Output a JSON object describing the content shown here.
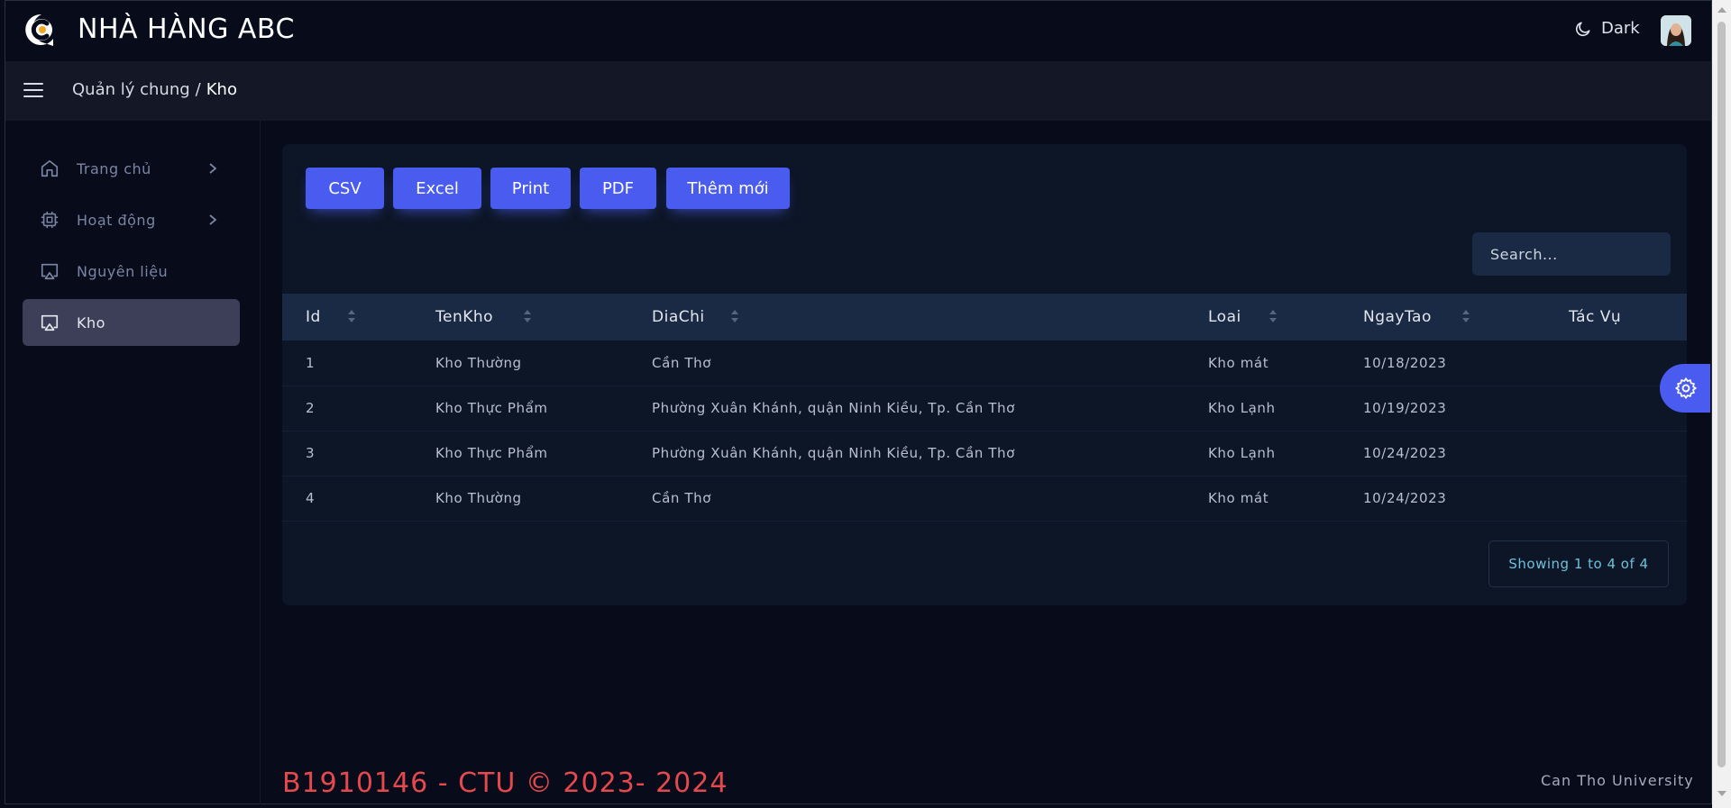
{
  "header": {
    "brand": "NHÀ HÀNG ABC",
    "theme_label": "Dark",
    "logo_icon": "c-logo-icon",
    "theme_icon": "moon-icon"
  },
  "breadcrumb": {
    "parent": "Quản lý chung",
    "separator": "/",
    "current": "Kho"
  },
  "sidebar": {
    "items": [
      {
        "label": "Trang chủ",
        "icon": "home-icon",
        "has_submenu": true
      },
      {
        "label": "Hoạt động",
        "icon": "cpu-icon",
        "has_submenu": true
      },
      {
        "label": "Nguyên liệu",
        "icon": "monitor-icon",
        "has_submenu": false
      },
      {
        "label": "Kho",
        "icon": "monitor-icon",
        "has_submenu": false,
        "active": true
      }
    ]
  },
  "toolbar": {
    "csv": "CSV",
    "excel": "Excel",
    "print": "Print",
    "pdf": "PDF",
    "add_new": "Thêm mới"
  },
  "search": {
    "placeholder": "Search..."
  },
  "table": {
    "columns": [
      "Id",
      "TenKho",
      "DiaChi",
      "Loai",
      "NgayTao",
      "Tác Vụ"
    ],
    "rows": [
      {
        "id": "1",
        "tenkho": "Kho Thường",
        "diachi": "Cần Thơ",
        "loai": "Kho mát",
        "ngaytao": "10/18/2023"
      },
      {
        "id": "2",
        "tenkho": "Kho Thực Phẩm",
        "diachi": "Phường Xuân Khánh, quận Ninh Kiều, Tp. Cần Thơ",
        "loai": "Kho Lạnh",
        "ngaytao": "10/19/2023"
      },
      {
        "id": "3",
        "tenkho": "Kho Thực Phẩm",
        "diachi": "Phường Xuân Khánh, quận Ninh Kiều, Tp. Cần Thơ",
        "loai": "Kho Lạnh",
        "ngaytao": "10/24/2023"
      },
      {
        "id": "4",
        "tenkho": "Kho Thường",
        "diachi": "Cần Thơ",
        "loai": "Kho mát",
        "ngaytao": "10/24/2023"
      }
    ],
    "info": "Showing 1 to 4 of 4"
  },
  "footer": {
    "left": "B1910146 - CTU © 2023- 2024",
    "right": "Can Tho University"
  },
  "colors": {
    "accent": "#4a5bef",
    "background": "#070b1a",
    "card": "#0d1627",
    "table_header": "#1a2a44",
    "footer_text": "#e5484d"
  }
}
